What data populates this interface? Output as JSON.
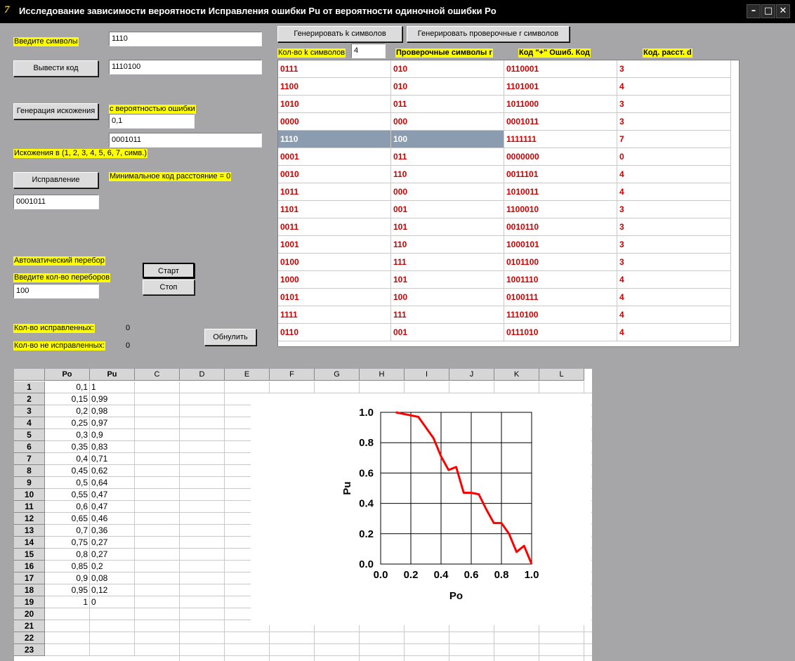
{
  "window": {
    "title": "Исследование зависимости вероятности Исправления ошибки Pu от вероятности одиночной ошибки Po",
    "app_icon_glyph": "7",
    "minimize_glyph": "–",
    "maximize_glyph": "□",
    "close_glyph": "✕"
  },
  "left": {
    "enter_symbols_label": "Введите символы",
    "symbols_value": "1110",
    "output_code_button": "Вывести код",
    "code_value": "1110100",
    "distortion_button": "Генерация искожения",
    "error_prob_label": "с вероятностью ошибки",
    "error_prob_value": "0,1",
    "distorted_value": "0001011",
    "distortions_in_label": "Искожения в (1, 2, 3, 4, 5, 6, 7,  симв.)",
    "correction_button": "Исправление",
    "min_distance_label": "Минимальное код расстояние = 0",
    "corrected_value": "0001011",
    "auto_label": "Автоматический перебор",
    "iterations_label": "Введите кол-во переборов",
    "iterations_value": "100",
    "start_button": "Старт",
    "stop_button": "Стоп",
    "corrected_count_label": "Кол-во исправленных:",
    "corrected_count": "0",
    "not_corrected_label": "Кол-во не исправленных:",
    "not_corrected_count": "0",
    "reset_button": "Обнулить"
  },
  "top": {
    "gen_k_button": "Генерировать k символов",
    "gen_r_button": "Генерировать проверочные r символов",
    "k_count_label": "Кол-во k символов",
    "k_count_value": "4"
  },
  "code_table": {
    "headers": [
      "Проверочные символы r",
      "Код \"+\" Ошиб. Код",
      "Код. расст. d"
    ],
    "selected_row": 4,
    "rows": [
      [
        "0111",
        "010",
        "0110001",
        "3"
      ],
      [
        "1100",
        "010",
        "1101001",
        "4"
      ],
      [
        "1010",
        "011",
        "1011000",
        "3"
      ],
      [
        "0000",
        "000",
        "0001011",
        "3"
      ],
      [
        "1110",
        "100",
        "1111111",
        "7"
      ],
      [
        "0001",
        "011",
        "0000000",
        "0"
      ],
      [
        "0010",
        "110",
        "0011101",
        "4"
      ],
      [
        "1011",
        "000",
        "1010011",
        "4"
      ],
      [
        "1101",
        "001",
        "1100010",
        "3"
      ],
      [
        "0011",
        "101",
        "0010110",
        "3"
      ],
      [
        "1001",
        "110",
        "1000101",
        "3"
      ],
      [
        "0100",
        "111",
        "0101100",
        "3"
      ],
      [
        "1000",
        "101",
        "1001110",
        "4"
      ],
      [
        "0101",
        "100",
        "0100111",
        "4"
      ],
      [
        "1111",
        "111",
        "1110100",
        "4"
      ],
      [
        "0110",
        "001",
        "0111010",
        "4"
      ]
    ]
  },
  "sheet": {
    "columns": [
      "Po",
      "Pu",
      "C",
      "D",
      "E",
      "F",
      "G",
      "H",
      "I",
      "J",
      "K",
      "L"
    ],
    "row_numbers": [
      "1",
      "2",
      "3",
      "4",
      "5",
      "6",
      "7",
      "8",
      "9",
      "10",
      "11",
      "12",
      "13",
      "14",
      "15",
      "16",
      "17",
      "18",
      "19",
      "20",
      "21",
      "22",
      "23"
    ],
    "po": [
      "0,1",
      "0,15",
      "0,2",
      "0,25",
      "0,3",
      "0,35",
      "0,4",
      "0,45",
      "0,5",
      "0,55",
      "0,6",
      "0,65",
      "0,7",
      "0,75",
      "0,8",
      "0,85",
      "0,9",
      "0,95",
      "1"
    ],
    "pu": [
      "1",
      "0,99",
      "0,98",
      "0,97",
      "0,9",
      "0,83",
      "0,71",
      "0,62",
      "0,64",
      "0,47",
      "0,47",
      "0,46",
      "0,36",
      "0,27",
      "0,27",
      "0,2",
      "0,08",
      "0,12",
      "0"
    ]
  },
  "chart_data": {
    "type": "line",
    "title": "",
    "xlabel": "Po",
    "ylabel": "Pu",
    "xlim": [
      0,
      1
    ],
    "ylim": [
      0,
      1
    ],
    "xticks": [
      "0.0",
      "0.2",
      "0.4",
      "0.6",
      "0.8",
      "1.0"
    ],
    "yticks": [
      "0.0",
      "0.2",
      "0.4",
      "0.6",
      "0.8",
      "1.0"
    ],
    "grid": true,
    "series": [
      {
        "color": "#ff0000",
        "x": [
          0.1,
          0.15,
          0.2,
          0.25,
          0.3,
          0.35,
          0.4,
          0.45,
          0.5,
          0.55,
          0.6,
          0.65,
          0.7,
          0.75,
          0.8,
          0.85,
          0.9,
          0.95,
          1.0
        ],
        "y": [
          1,
          0.99,
          0.98,
          0.97,
          0.9,
          0.83,
          0.71,
          0.62,
          0.64,
          0.47,
          0.47,
          0.46,
          0.36,
          0.27,
          0.27,
          0.2,
          0.08,
          0.12,
          0
        ]
      }
    ]
  }
}
